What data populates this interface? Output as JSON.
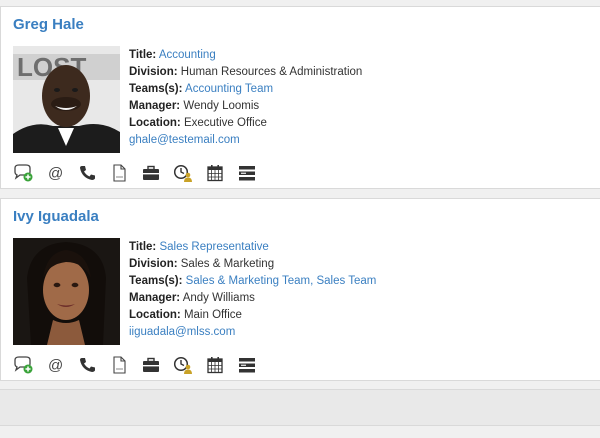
{
  "people": [
    {
      "name": "Greg Hale",
      "title_label": "Title:",
      "title": "Accounting",
      "division_label": "Division:",
      "division": "Human Resources & Administration",
      "teams_label": "Teams(s):",
      "teams": "Accounting Team",
      "manager_label": "Manager:",
      "manager": "Wendy Loomis",
      "location_label": "Location:",
      "location": "Executive Office",
      "email": "ghale@testemail.com"
    },
    {
      "name": "Ivy Iguadala",
      "title_label": "Title:",
      "title": "Sales Representative",
      "division_label": "Division:",
      "division": "Sales & Marketing",
      "teams_label": "Teams(s):",
      "teams": "Sales & Marketing Team, Sales Team",
      "manager_label": "Manager:",
      "manager": "Andy Williams",
      "location_label": "Location:",
      "location": "Main Office",
      "email": "iiguadala@mlss.com"
    }
  ],
  "action_icons": [
    "chat-add-icon",
    "at-sign-icon",
    "phone-icon",
    "document-icon",
    "briefcase-icon",
    "clock-user-icon",
    "calendar-icon",
    "list-icon"
  ],
  "colors": {
    "link": "#3a7fc1",
    "text": "#333333",
    "icon": "#444444",
    "add_green": "#3aa33a",
    "user_gold": "#c9a227"
  }
}
